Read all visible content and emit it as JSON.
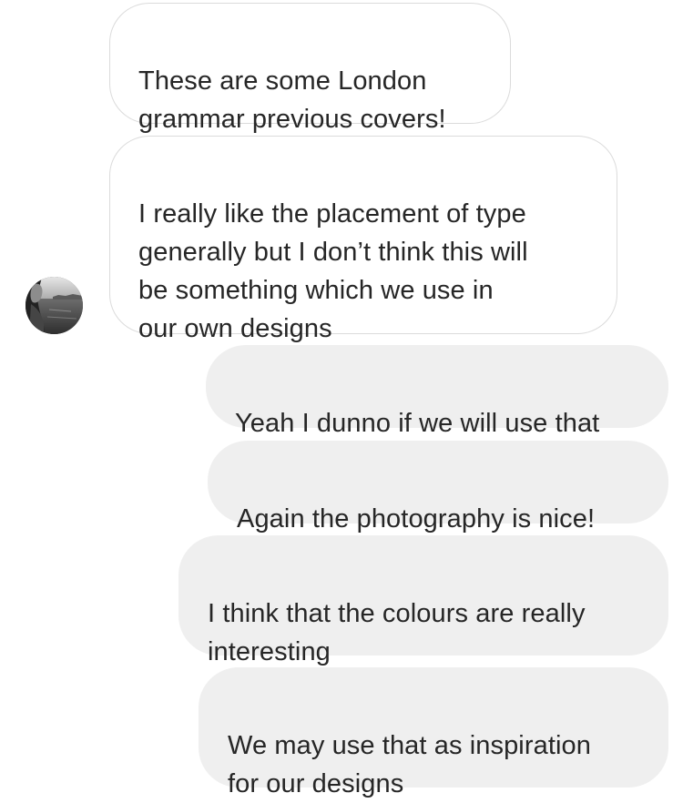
{
  "thread": {
    "sender_avatar": {
      "icon": "profile-photo-avatar",
      "description_colors": [
        "#2b2b2b",
        "#9a9a9a",
        "#d9d9d9"
      ]
    },
    "incoming_messages": [
      {
        "text": "These are some London\ngrammar previous covers!"
      },
      {
        "text": "I really like the placement of type\ngenerally but I don’t think this will\nbe something which we use in\nour own designs"
      }
    ],
    "outgoing_messages": [
      {
        "text": "Yeah I dunno if we will use that"
      },
      {
        "text": "Again the photography is nice!"
      },
      {
        "text": "I think that the colours are really\ninteresting"
      },
      {
        "text": "We may use that as inspiration\nfor our designs"
      }
    ]
  },
  "colors": {
    "incoming_bg": "#ffffff",
    "incoming_border": "#dbdbdb",
    "outgoing_bg": "#efefef",
    "text": "#262626"
  }
}
